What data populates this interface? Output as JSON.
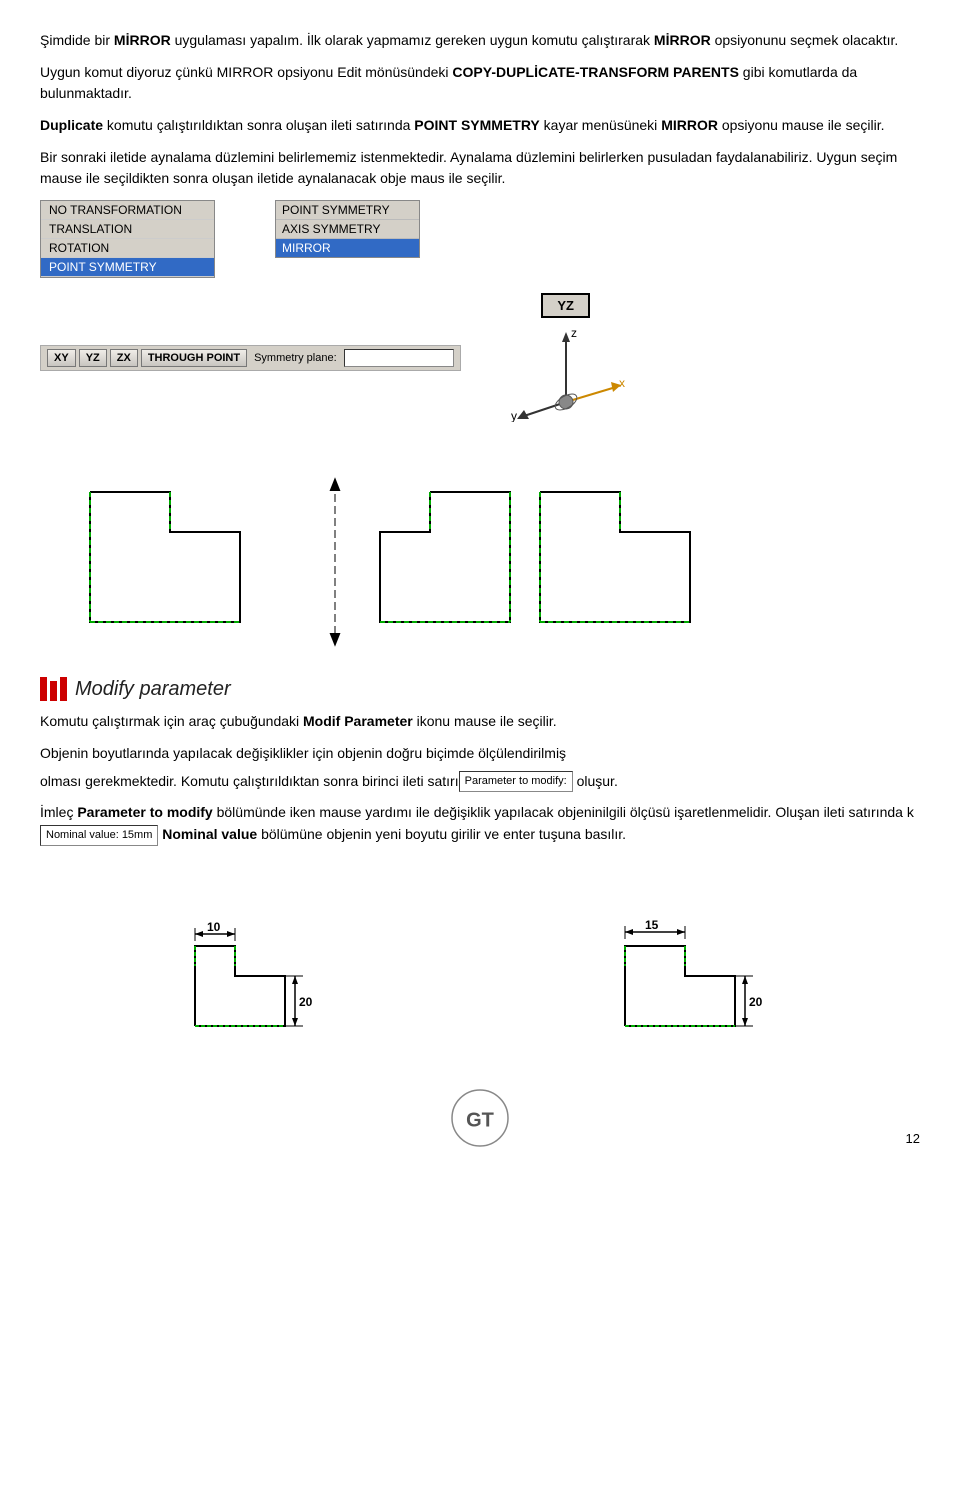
{
  "page": {
    "number": "12"
  },
  "paragraphs": {
    "p1": "Şimdide bir MİRROR uygulaması yapalım. İlk olarak yapmamız gereken uygun komutu çalıştırarak MİRROR opsiyonunu seçmek olacaktır.",
    "p1_mirror1": "MİRROR",
    "p2_prefix": "Uygun komut diyoruz çünkü MIRROR opsiyonu Edit mönüsündeki ",
    "p2_bold": "COPY-DUPLİCATE-TRANSFORM PARENTS",
    "p2_suffix": " gibi komutlarda da bulunmaktadır.",
    "p3_prefix": "",
    "p3_bold1": "Duplicate",
    "p3_mid": " komutu çalıştırıldıktan sonra oluşan ileti satırında ",
    "p3_bold2": "POINT SYMMETRY",
    "p3_mid2": " kayar menüsüneki ",
    "p3_bold3": "MIRROR",
    "p3_suffix": " opsiyonu mause ile seçilir.",
    "p4": "Bir sonraki iletide aynalama düzlemini belirlememiz istenmektedir. Aynalama düzlemini belirlerken pusuladan faydalanabiliriz. Uygun seçim mause ile seçildikten sonra oluşan iletide aynalanacak obje maus ile seçilir.",
    "transform_items": [
      {
        "label": "NO TRANSFORMATION",
        "highlighted": false
      },
      {
        "label": "TRANSLATION",
        "highlighted": false
      },
      {
        "label": "ROTATION",
        "highlighted": false
      },
      {
        "label": "POINT SYMMETRY",
        "highlighted": true
      }
    ],
    "point_sym_items": [
      {
        "label": "POINT SYMMETRY",
        "highlighted": false
      },
      {
        "label": "AXIS SYMMETRY",
        "highlighted": false
      },
      {
        "label": "MIRROR",
        "highlighted": true
      }
    ],
    "sym_buttons": [
      "XY",
      "YZ",
      "ZX",
      "THROUGH POINT"
    ],
    "sym_label": "Symmetry plane:",
    "yz_badge": "YZ",
    "modify_title": "Modify parameter",
    "mp1_prefix": "Komutu çalıştırmak için araç çubuğundaki ",
    "mp1_bold": "Modif Parameter",
    "mp1_suffix": " ikonu mause ile seçilir.",
    "mp2": "Objenin boyutlarında yapılacak değişiklikler için objenin doğru biçimde ölçülendirilmiş",
    "mp3": "olması gerekmektedir. Komutu çalıştırıldıktan sonra birinci ileti satırı",
    "mp3_ui": "Parameter to modify:",
    "mp3_suffix": " oluşur.",
    "mp4_prefix": "İmleç ",
    "mp4_bold": "Parameter to modify",
    "mp4_mid": " bölümünde iken mause yardımı ile değişiklik yapılacak objeninilgili ölçüsü işaretlenmelidir. Oluşan ileti satırında k",
    "mp4_ui": "Nominal value: 15mm",
    "mp4_bold2": "Nominal value",
    "mp4_suffix": " bölümüne objenin yeni boyutu girilir ve enter tuşuna basılır.",
    "dim_left": {
      "w": "10",
      "h": "20"
    },
    "dim_right": {
      "w": "15",
      "h": "20"
    }
  }
}
